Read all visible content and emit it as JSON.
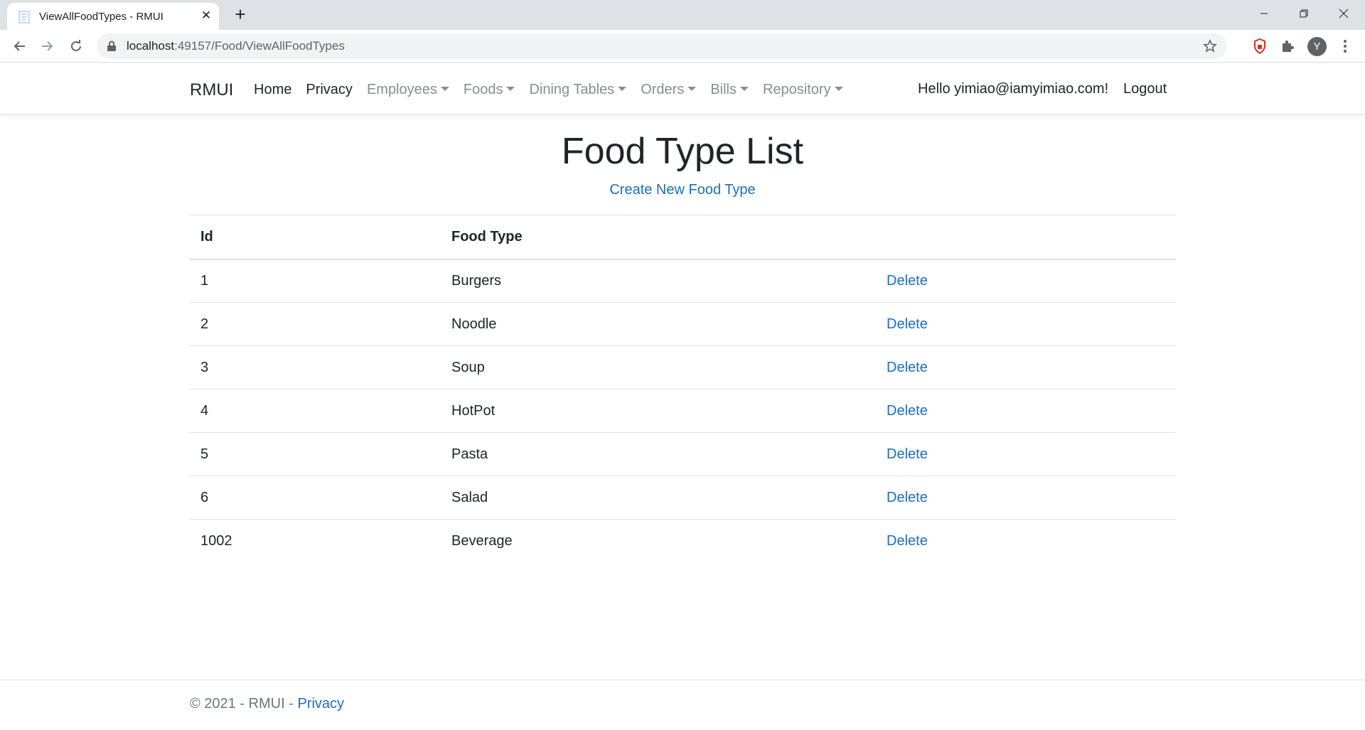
{
  "browser": {
    "tab_title": "ViewAllFoodTypes - RMUI",
    "url_host": "localhost",
    "url_path": ":49157/Food/ViewAllFoodTypes",
    "avatar_letter": "Y"
  },
  "navbar": {
    "brand": "RMUI",
    "items": [
      {
        "label": "Home",
        "dropdown": false
      },
      {
        "label": "Privacy",
        "dropdown": false
      },
      {
        "label": "Employees",
        "dropdown": true
      },
      {
        "label": "Foods",
        "dropdown": true
      },
      {
        "label": "Dining Tables",
        "dropdown": true
      },
      {
        "label": "Orders",
        "dropdown": true
      },
      {
        "label": "Bills",
        "dropdown": true
      },
      {
        "label": "Repository",
        "dropdown": true
      }
    ],
    "greeting": "Hello yimiao@iamyimiao.com!",
    "logout": "Logout"
  },
  "main": {
    "title": "Food Type List",
    "create_link": "Create New Food Type",
    "table": {
      "headers": [
        "Id",
        "Food Type",
        ""
      ],
      "rows": [
        {
          "id": "1",
          "type": "Burgers",
          "action": "Delete"
        },
        {
          "id": "2",
          "type": "Noodle",
          "action": "Delete"
        },
        {
          "id": "3",
          "type": "Soup",
          "action": "Delete"
        },
        {
          "id": "4",
          "type": "HotPot",
          "action": "Delete"
        },
        {
          "id": "5",
          "type": "Pasta",
          "action": "Delete"
        },
        {
          "id": "6",
          "type": "Salad",
          "action": "Delete"
        },
        {
          "id": "1002",
          "type": "Beverage",
          "action": "Delete"
        }
      ]
    }
  },
  "footer": {
    "copyright": "© 2021 - RMUI - ",
    "privacy": "Privacy"
  },
  "colors": {
    "link": "#1b6ec2",
    "muted_nav": "#8a8d91",
    "text": "#212529"
  },
  "icons": {
    "tab_favicon": "document-icon",
    "lock": "lock-icon",
    "star": "star-icon",
    "ext1": "shield-extension-icon",
    "ext2": "puzzle-extension-icon"
  }
}
